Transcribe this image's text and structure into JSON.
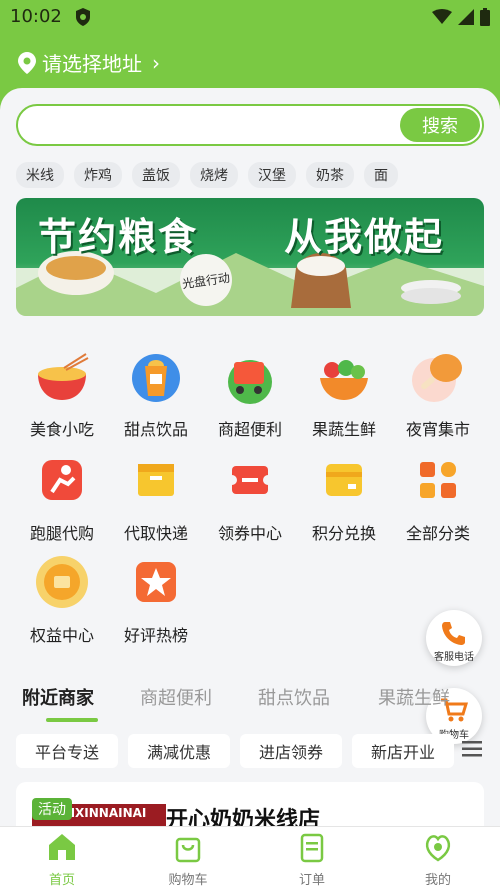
{
  "status": {
    "time": "10:02"
  },
  "header": {
    "address": "请选择地址",
    "chevron": "›"
  },
  "search": {
    "placeholder": "",
    "button": "搜索"
  },
  "tags": [
    "米线",
    "炸鸡",
    "盖饭",
    "烧烤",
    "汉堡",
    "奶茶",
    "面"
  ],
  "banner": {
    "line1": "节约粮食",
    "line2": "从我做起",
    "seal": "光盘行动"
  },
  "categories": [
    {
      "label": "美食小吃",
      "icon": "noodle-bowl-icon"
    },
    {
      "label": "甜点饮品",
      "icon": "drink-cup-icon"
    },
    {
      "label": "商超便利",
      "icon": "shopping-cart-icon"
    },
    {
      "label": "果蔬生鲜",
      "icon": "fruit-basket-icon"
    },
    {
      "label": "夜宵集市",
      "icon": "drumstick-icon"
    },
    {
      "label": "跑腿代购",
      "icon": "runner-icon"
    },
    {
      "label": "代取快递",
      "icon": "parcel-box-icon"
    },
    {
      "label": "领券中心",
      "icon": "coupon-icon"
    },
    {
      "label": "积分兑换",
      "icon": "points-card-icon"
    },
    {
      "label": "全部分类",
      "icon": "grid-icon"
    },
    {
      "label": "权益中心",
      "icon": "benefit-badge-icon"
    },
    {
      "label": "好评热榜",
      "icon": "star-icon"
    }
  ],
  "floating": {
    "service": "客服电话",
    "cart": "购物车"
  },
  "tabs": [
    "附近商家",
    "商超便利",
    "甜点饮品",
    "果蔬生鲜"
  ],
  "filters": [
    "平台专送",
    "满减优惠",
    "进店领券",
    "新店开业"
  ],
  "shop": {
    "badge": "活动",
    "name": "开心奶奶米线店",
    "logo_text": "KAIXINNAINAI"
  },
  "nav": [
    {
      "label": "首页",
      "icon": "home-icon"
    },
    {
      "label": "购物车",
      "icon": "bag-icon"
    },
    {
      "label": "订单",
      "icon": "order-icon"
    },
    {
      "label": "我的",
      "icon": "profile-icon"
    }
  ],
  "colors": {
    "brand": "#7ac943",
    "background": "#f4f5f7"
  }
}
